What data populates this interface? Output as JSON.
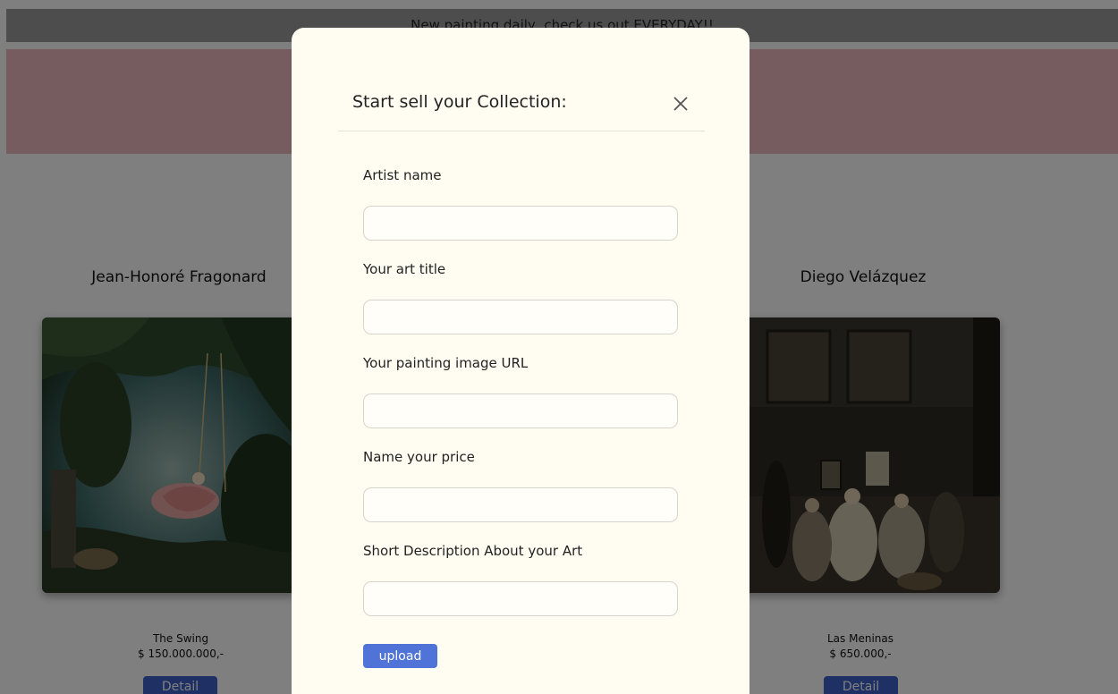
{
  "banner": {
    "announcement": "New painting daily, check us out EVERYDAY!!"
  },
  "gallery": {
    "left": {
      "artist": "Jean-Honoré Fragonard",
      "title": "The Swing",
      "price": "$ 150.000.000,-",
      "detail_label": "Detail"
    },
    "right": {
      "artist": "Diego Velázquez",
      "title": "Las Meninas",
      "price": "$ 650.000,-",
      "detail_label": "Detail"
    }
  },
  "modal": {
    "title": "Start sell your Collection:",
    "fields": [
      {
        "label": "Artist name",
        "value": ""
      },
      {
        "label": "Your art title",
        "value": ""
      },
      {
        "label": "Your painting image URL",
        "value": ""
      },
      {
        "label": "Name your price",
        "value": ""
      },
      {
        "label": "Short Description About your Art",
        "value": ""
      }
    ],
    "submit_label": "upload"
  },
  "colors": {
    "hero": "#efb8bf",
    "modal_bg": "#fffdf2",
    "button": "#4f73d6"
  }
}
